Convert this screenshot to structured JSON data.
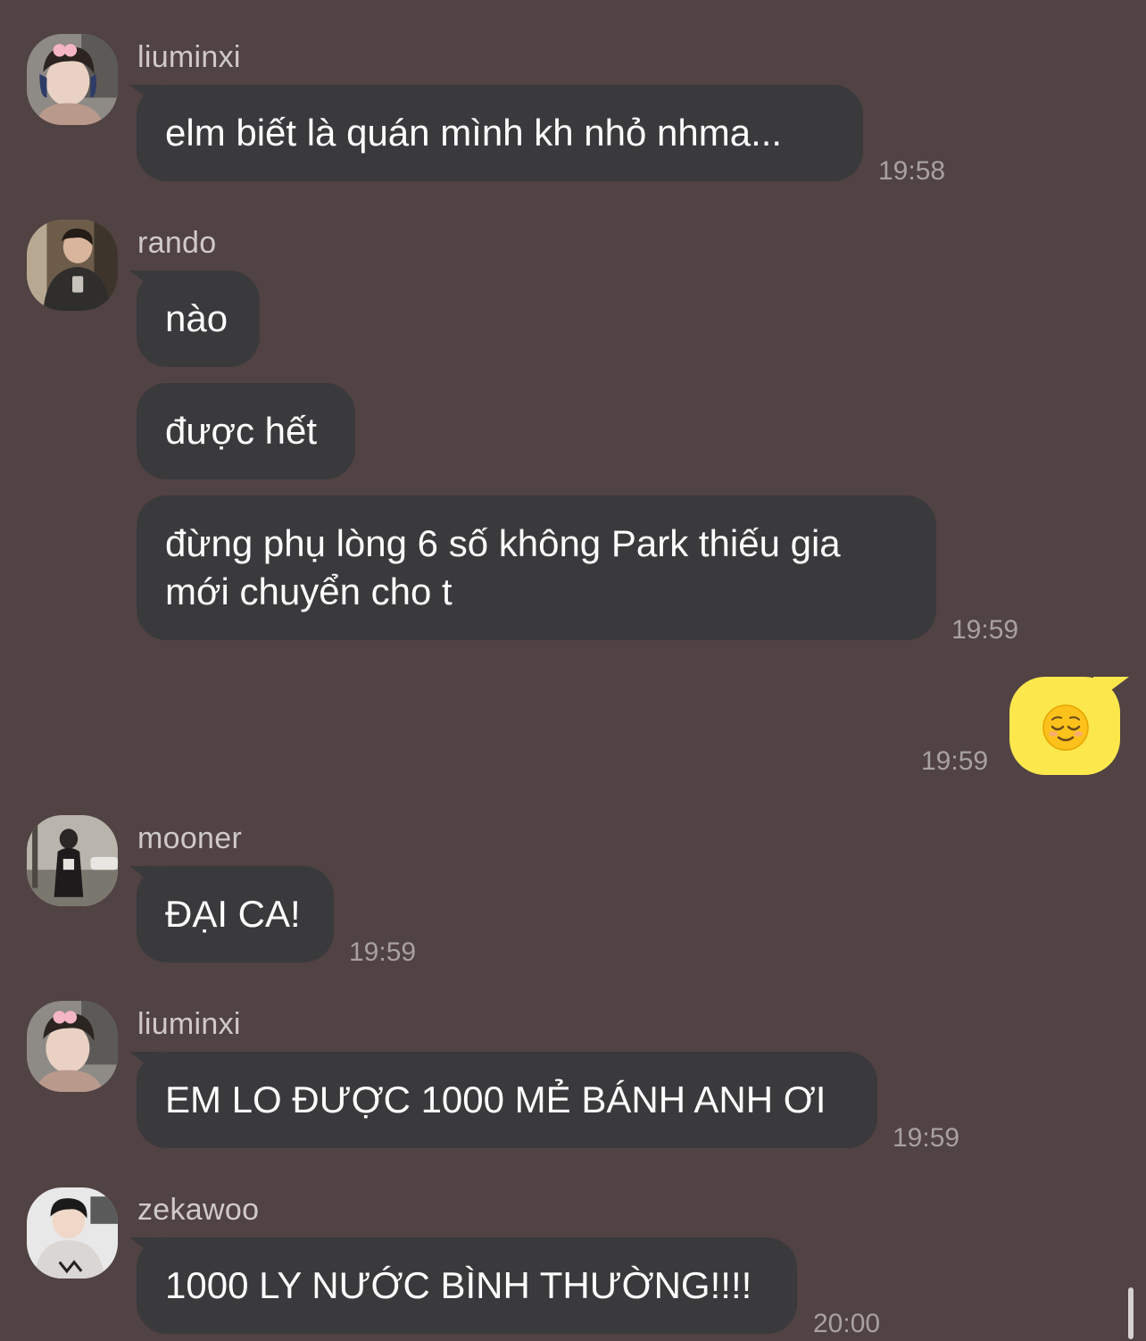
{
  "colors": {
    "background": "#514243",
    "bubble_other": "#3a393b",
    "bubble_me": "#fce84d",
    "sender_text": "#cfc9ca",
    "timestamp_text": "#a8a1a2"
  },
  "messages": [
    {
      "sender": "liuminxi",
      "avatar_icon": "avatar-liuminxi",
      "bubbles": [
        "elm biết là quán mình kh nhỏ nhma..."
      ],
      "time": "19:58"
    },
    {
      "sender": "rando",
      "avatar_icon": "avatar-rando",
      "bubbles": [
        "nào",
        "được hết",
        "đừng phụ lòng 6 số không Park thiếu gia",
        "mới chuyển cho t"
      ],
      "time": "19:59"
    },
    {
      "sender": "me",
      "bubbles": [],
      "emoji_icon": "relieved-face-emoji",
      "time": "19:59"
    },
    {
      "sender": "mooner",
      "avatar_icon": "avatar-mooner",
      "bubbles": [
        "ĐẠI CA!"
      ],
      "time": "19:59"
    },
    {
      "sender": "liuminxi",
      "avatar_icon": "avatar-liuminxi",
      "bubbles": [
        "EM LO ĐƯỢC 1000 MẺ BÁNH ANH ƠI"
      ],
      "time": "19:59"
    },
    {
      "sender": "zekawoo",
      "avatar_icon": "avatar-zekawoo",
      "bubbles": [
        "1000 LY NƯỚC BÌNH THƯỜNG!!!!"
      ],
      "time": "20:00"
    }
  ]
}
